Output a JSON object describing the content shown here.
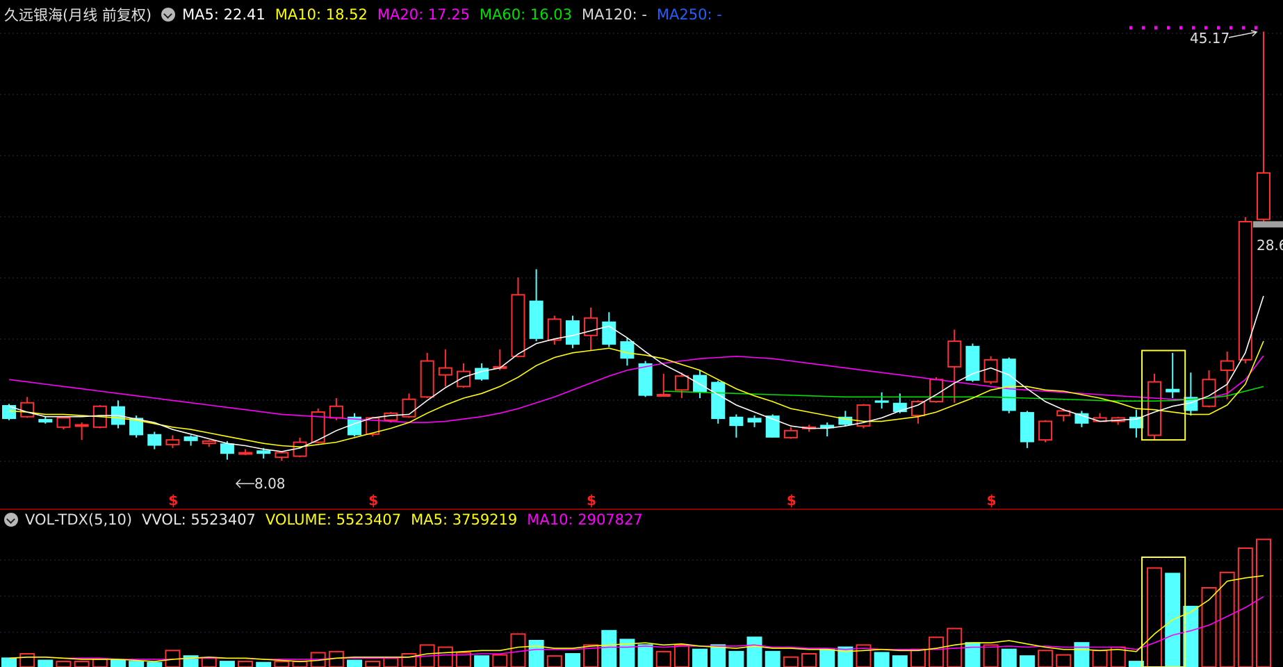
{
  "header": {
    "title": "久远银海(月线 前复权)",
    "items": [
      {
        "label": "MA5: 22.41",
        "color": "#ffffff"
      },
      {
        "label": "MA10: 18.52",
        "color": "#ffff00"
      },
      {
        "label": "MA20: 17.25",
        "color": "#ff00ff"
      },
      {
        "label": "MA60: 16.03",
        "color": "#00e000"
      },
      {
        "label": "MA120: -",
        "color": "#d8d8d8"
      },
      {
        "label": "MA250: -",
        "color": "#2060ff"
      }
    ]
  },
  "vol_header": {
    "title": "VOL-TDX(5,10)",
    "items": [
      {
        "label": "VVOL: 5523407",
        "color": "#e8e8e8"
      },
      {
        "label": "VOLUME: 5523407",
        "color": "#ffff00"
      },
      {
        "label": "MA5: 3759219",
        "color": "#ffff00"
      },
      {
        "label": "MA10: 2907827",
        "color": "#ff00ff"
      }
    ]
  },
  "annotations": {
    "low_label": "8.08",
    "high_label": "45.17",
    "last_label": "28.6",
    "marker_symbol": "$"
  },
  "chart_data": {
    "type": "candlestick",
    "ylim": [
      6,
      45.5
    ],
    "candles": [
      [
        13.0,
        11.8,
        13.1,
        11.7
      ],
      [
        12.0,
        13.2,
        13.7,
        11.9
      ],
      [
        11.8,
        11.5,
        12.0,
        11.4
      ],
      [
        11.1,
        11.9,
        12.0,
        10.9
      ],
      [
        11.3,
        11.3,
        11.5,
        10.0
      ],
      [
        11.1,
        12.9,
        13.0,
        11.0
      ],
      [
        12.9,
        11.3,
        13.4,
        11.0
      ],
      [
        11.9,
        10.4,
        12.1,
        10.2
      ],
      [
        10.5,
        9.5,
        10.7,
        9.2
      ],
      [
        9.6,
        10.0,
        10.4,
        9.3
      ],
      [
        10.3,
        9.9,
        10.4,
        9.5
      ],
      [
        9.7,
        9.9,
        10.0,
        9.4
      ],
      [
        9.7,
        8.8,
        9.9,
        8.3
      ],
      [
        8.8,
        8.9,
        9.2,
        8.7
      ],
      [
        9.1,
        8.8,
        9.3,
        8.4
      ],
      [
        8.5,
        8.9,
        9.0,
        8.2
      ],
      [
        8.6,
        9.8,
        10.2,
        8.5
      ],
      [
        9.8,
        12.4,
        12.7,
        9.7
      ],
      [
        11.9,
        12.9,
        13.6,
        11.7
      ],
      [
        12.0,
        10.4,
        12.3,
        10.3
      ],
      [
        10.5,
        11.9,
        12.0,
        10.3
      ],
      [
        11.7,
        12.3,
        12.4,
        11.5
      ],
      [
        12.0,
        13.5,
        14.0,
        11.9
      ],
      [
        13.7,
        16.8,
        17.5,
        13.6
      ],
      [
        15.6,
        16.2,
        17.8,
        14.6
      ],
      [
        14.6,
        15.9,
        16.6,
        14.5
      ],
      [
        16.2,
        15.2,
        16.6,
        15.1
      ],
      [
        16.2,
        16.3,
        17.8,
        16.0
      ],
      [
        17.2,
        22.5,
        24.0,
        17.1
      ],
      [
        22.0,
        18.7,
        24.7,
        18.5
      ],
      [
        18.6,
        20.4,
        20.7,
        18.2
      ],
      [
        20.3,
        18.2,
        20.7,
        17.9
      ],
      [
        19.0,
        20.5,
        21.4,
        17.7
      ],
      [
        20.2,
        18.2,
        21.0,
        18.0
      ],
      [
        18.5,
        17.0,
        18.8,
        16.4
      ],
      [
        16.6,
        13.8,
        16.8,
        13.7
      ],
      [
        13.9,
        13.9,
        15.7,
        13.8
      ],
      [
        14.3,
        15.5,
        15.8,
        13.6
      ],
      [
        15.6,
        14.1,
        16.0,
        13.6
      ],
      [
        15.0,
        11.8,
        15.1,
        11.4
      ],
      [
        12.0,
        11.2,
        12.2,
        10.2
      ],
      [
        11.9,
        11.5,
        12.1,
        11.1
      ],
      [
        12.1,
        10.2,
        12.2,
        10.2
      ],
      [
        10.2,
        10.8,
        11.1,
        10.1
      ],
      [
        11.1,
        11.1,
        11.3,
        10.7
      ],
      [
        11.3,
        11.0,
        11.5,
        10.3
      ],
      [
        12.0,
        11.3,
        12.5,
        11.2
      ],
      [
        11.2,
        13.0,
        13.1,
        11.0
      ],
      [
        13.4,
        13.2,
        14.1,
        12.7
      ],
      [
        13.2,
        12.4,
        14.0,
        12.3
      ],
      [
        12.1,
        13.3,
        13.4,
        11.4
      ],
      [
        13.3,
        15.2,
        15.4,
        13.2
      ],
      [
        16.3,
        18.5,
        19.5,
        13.2
      ],
      [
        18.1,
        15.1,
        18.3,
        15.0
      ],
      [
        15.0,
        16.9,
        17.2,
        14.8
      ],
      [
        17.0,
        12.5,
        17.1,
        12.3
      ],
      [
        12.4,
        9.8,
        12.5,
        9.3
      ],
      [
        10.0,
        11.6,
        11.7,
        9.8
      ],
      [
        12.1,
        12.5,
        12.7,
        11.6
      ],
      [
        12.3,
        11.4,
        12.5,
        11.1
      ],
      [
        11.6,
        11.9,
        12.3,
        11.7
      ],
      [
        11.6,
        11.9,
        12.0,
        11.3
      ],
      [
        12.0,
        11.0,
        12.6,
        10.2
      ],
      [
        10.4,
        15.0,
        15.7,
        10.0
      ],
      [
        14.4,
        14.1,
        17.5,
        13.6
      ],
      [
        13.7,
        12.5,
        15.8,
        12.1
      ],
      [
        12.9,
        15.2,
        16.0,
        12.8
      ],
      [
        16.0,
        16.8,
        17.6,
        13.5
      ],
      [
        16.9,
        28.8,
        29.2,
        16.6
      ],
      [
        29.0,
        33.0,
        45.17,
        28.6
      ]
    ],
    "ma5": [
      12.9,
      12.4,
      12.0,
      12.0,
      12.0,
      12.1,
      12.1,
      11.8,
      11.5,
      10.9,
      10.5,
      10.1,
      9.7,
      9.5,
      9.2,
      9.0,
      9.3,
      10.0,
      10.8,
      11.4,
      11.9,
      12.1,
      12.2,
      13.4,
      14.5,
      15.4,
      15.9,
      16.2,
      17.4,
      18.3,
      18.7,
      19.0,
      19.4,
      19.8,
      18.8,
      17.6,
      16.5,
      15.7,
      14.8,
      13.9,
      13.0,
      12.4,
      11.8,
      11.2,
      11.0,
      11.0,
      11.2,
      11.5,
      11.9,
      12.5,
      13.0,
      13.9,
      14.9,
      15.7,
      16.2,
      15.6,
      14.4,
      13.3,
      12.6,
      12.1,
      11.6,
      11.7,
      11.8,
      12.4,
      12.9,
      13.2,
      13.8,
      14.8,
      17.5,
      22.4
    ],
    "ma10": [
      12.5,
      12.4,
      12.2,
      12.2,
      12.1,
      12.0,
      11.9,
      11.7,
      11.4,
      11.1,
      10.9,
      10.6,
      10.3,
      10.0,
      9.7,
      9.5,
      9.4,
      9.6,
      9.8,
      10.2,
      10.6,
      11.0,
      11.5,
      12.3,
      13.0,
      13.6,
      14.0,
      14.6,
      15.4,
      16.4,
      17.1,
      17.5,
      17.7,
      17.9,
      17.5,
      17.3,
      17.0,
      16.5,
      16.0,
      15.2,
      14.4,
      13.8,
      13.3,
      12.7,
      12.4,
      12.1,
      11.8,
      11.6,
      11.6,
      11.8,
      12.0,
      12.4,
      13.0,
      13.6,
      14.3,
      14.6,
      14.6,
      14.3,
      14.2,
      13.9,
      13.6,
      13.2,
      12.7,
      12.6,
      12.4,
      12.2,
      12.2,
      13.0,
      14.8,
      18.5
    ],
    "ma20": [
      15.2,
      15.0,
      14.8,
      14.6,
      14.4,
      14.2,
      14.0,
      13.8,
      13.6,
      13.4,
      13.2,
      13.0,
      12.8,
      12.6,
      12.4,
      12.2,
      12.1,
      12.0,
      11.9,
      11.8,
      11.7,
      11.6,
      11.5,
      11.5,
      11.6,
      11.8,
      12.0,
      12.3,
      12.7,
      13.2,
      13.7,
      14.3,
      14.9,
      15.5,
      16.0,
      16.3,
      16.6,
      16.8,
      17.0,
      17.1,
      17.2,
      17.1,
      17.0,
      16.8,
      16.6,
      16.4,
      16.2,
      16.0,
      15.8,
      15.6,
      15.4,
      15.2,
      15.0,
      14.8,
      14.6,
      14.4,
      14.3,
      14.2,
      14.1,
      14.0,
      13.9,
      13.8,
      13.7,
      13.6,
      13.5,
      13.5,
      13.6,
      14.0,
      15.2,
      17.25
    ],
    "ma60": [
      null,
      null,
      null,
      null,
      null,
      null,
      null,
      null,
      null,
      null,
      null,
      null,
      null,
      null,
      null,
      null,
      null,
      null,
      null,
      null,
      null,
      null,
      null,
      null,
      null,
      null,
      null,
      null,
      null,
      null,
      null,
      null,
      null,
      null,
      null,
      null,
      14.2,
      14.15,
      14.1,
      14.05,
      14.0,
      13.95,
      13.9,
      13.85,
      13.8,
      13.75,
      13.7,
      13.7,
      13.7,
      13.7,
      13.7,
      13.7,
      13.7,
      13.7,
      13.7,
      13.65,
      13.6,
      13.55,
      13.5,
      13.45,
      13.4,
      13.35,
      13.35,
      13.35,
      13.4,
      13.5,
      13.6,
      13.8,
      14.2,
      14.6
    ],
    "volume": [
      0.08,
      0.12,
      0.06,
      0.05,
      0.05,
      0.07,
      0.06,
      0.05,
      0.04,
      0.15,
      0.1,
      0.08,
      0.05,
      0.05,
      0.04,
      0.05,
      0.05,
      0.13,
      0.14,
      0.06,
      0.05,
      0.08,
      0.12,
      0.2,
      0.18,
      0.13,
      0.1,
      0.11,
      0.3,
      0.24,
      0.1,
      0.12,
      0.2,
      0.33,
      0.25,
      0.2,
      0.14,
      0.2,
      0.16,
      0.2,
      0.14,
      0.27,
      0.14,
      0.09,
      0.12,
      0.16,
      0.18,
      0.2,
      0.13,
      0.1,
      0.16,
      0.27,
      0.35,
      0.22,
      0.2,
      0.16,
      0.1,
      0.15,
      0.11,
      0.22,
      0.15,
      0.18,
      0.05,
      0.9,
      0.85,
      0.55,
      0.72,
      0.86,
      1.08,
      1.16
    ],
    "vol_ma5": [
      0.08,
      0.09,
      0.09,
      0.08,
      0.07,
      0.07,
      0.07,
      0.06,
      0.05,
      0.07,
      0.08,
      0.09,
      0.08,
      0.08,
      0.07,
      0.06,
      0.05,
      0.06,
      0.08,
      0.09,
      0.09,
      0.09,
      0.09,
      0.12,
      0.13,
      0.14,
      0.15,
      0.15,
      0.18,
      0.19,
      0.17,
      0.17,
      0.19,
      0.2,
      0.21,
      0.22,
      0.2,
      0.21,
      0.19,
      0.18,
      0.17,
      0.19,
      0.17,
      0.17,
      0.16,
      0.16,
      0.14,
      0.15,
      0.16,
      0.15,
      0.15,
      0.17,
      0.2,
      0.22,
      0.22,
      0.24,
      0.21,
      0.18,
      0.16,
      0.16,
      0.15,
      0.16,
      0.14,
      0.3,
      0.43,
      0.5,
      0.61,
      0.78,
      0.81,
      0.83
    ],
    "vol_ma10": [
      0.08,
      0.09,
      0.09,
      0.08,
      0.08,
      0.08,
      0.07,
      0.07,
      0.07,
      0.07,
      0.08,
      0.08,
      0.08,
      0.08,
      0.07,
      0.07,
      0.07,
      0.07,
      0.08,
      0.08,
      0.08,
      0.08,
      0.09,
      0.1,
      0.11,
      0.11,
      0.12,
      0.12,
      0.14,
      0.16,
      0.16,
      0.16,
      0.17,
      0.18,
      0.18,
      0.19,
      0.18,
      0.19,
      0.19,
      0.19,
      0.19,
      0.2,
      0.18,
      0.18,
      0.17,
      0.17,
      0.16,
      0.17,
      0.16,
      0.16,
      0.16,
      0.16,
      0.17,
      0.18,
      0.18,
      0.19,
      0.18,
      0.19,
      0.18,
      0.18,
      0.18,
      0.18,
      0.16,
      0.22,
      0.29,
      0.33,
      0.38,
      0.46,
      0.54,
      0.64
    ],
    "s_markers": [
      9,
      20,
      32,
      43,
      54
    ]
  }
}
